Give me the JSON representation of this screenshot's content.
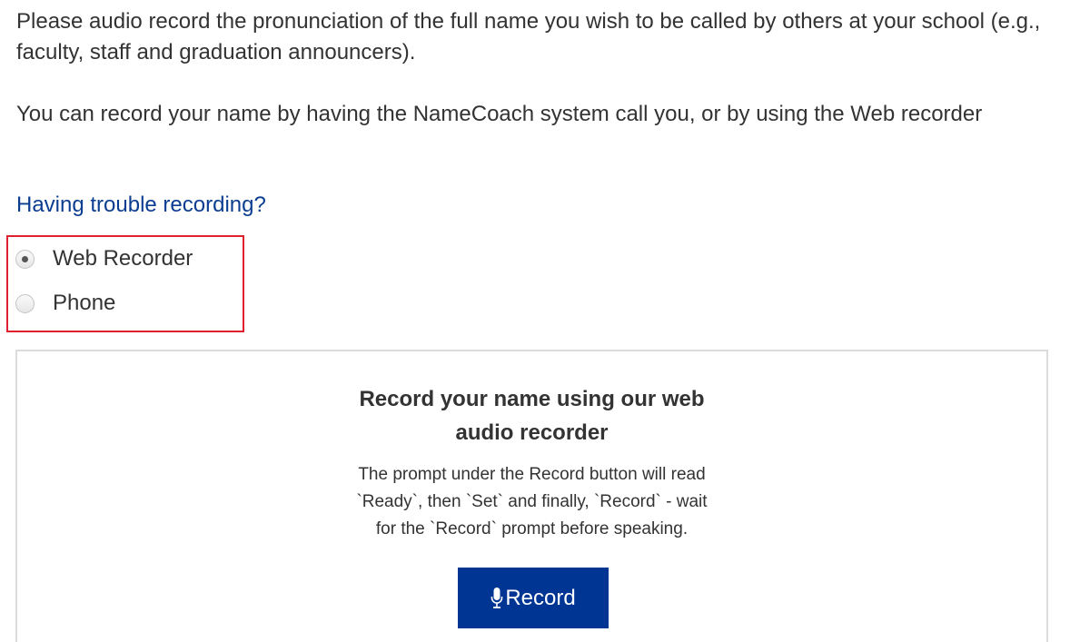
{
  "intro": {
    "paragraph1": "Please audio record the pronunciation of the full name you wish to be called by others at your school (e.g., faculty, staff and graduation announcers).",
    "paragraph2": "You can record your name by having the NameCoach system call you, or by using the Web recorder",
    "trouble_link": "Having trouble recording?"
  },
  "method_options": [
    {
      "label": "Web Recorder",
      "selected": true
    },
    {
      "label": "Phone",
      "selected": false
    }
  ],
  "recorder_panel": {
    "title_line1": "Record your name using our web",
    "title_line2": "audio recorder",
    "desc_line1": "The prompt under the Record button will read",
    "desc_line2": "`Ready`, then `Set` and finally, `Record` - wait",
    "desc_line3": "for the `Record` prompt before speaking.",
    "record_button_label": "Record",
    "record_button_icon": "microphone-icon"
  },
  "colors": {
    "link": "#0b3d91",
    "highlight_border": "#e0202e",
    "button_bg": "#003594",
    "text": "#333333"
  }
}
